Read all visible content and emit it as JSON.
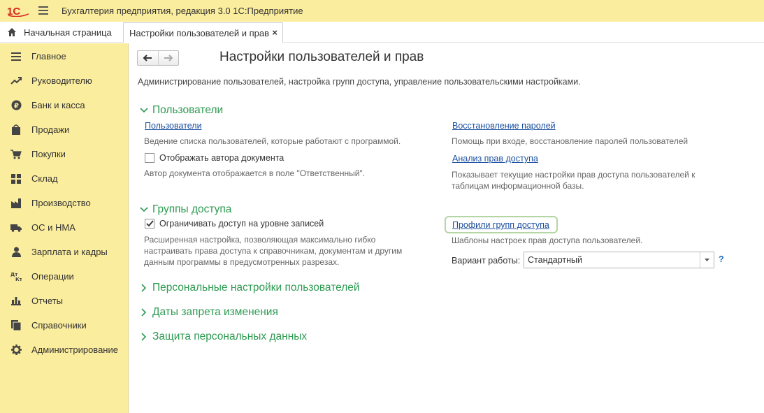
{
  "app": {
    "title": "Бухгалтерия предприятия, редакция 3.0 1С:Предприятие"
  },
  "tabs": {
    "home_label": "Начальная страница",
    "active_label": "Настройки пользователей и прав",
    "close_glyph": "×"
  },
  "sidebar": {
    "items": [
      {
        "label": "Главное",
        "icon": "list-icon"
      },
      {
        "label": "Руководителю",
        "icon": "trend-icon"
      },
      {
        "label": "Банк и касса",
        "icon": "ruble-icon"
      },
      {
        "label": "Продажи",
        "icon": "bag-icon"
      },
      {
        "label": "Покупки",
        "icon": "cart-icon"
      },
      {
        "label": "Склад",
        "icon": "grid-icon"
      },
      {
        "label": "Производство",
        "icon": "factory-icon"
      },
      {
        "label": "ОС и НМА",
        "icon": "truck-icon"
      },
      {
        "label": "Зарплата и кадры",
        "icon": "person-icon"
      },
      {
        "label": "Операции",
        "icon": "dt-kt-icon"
      },
      {
        "label": "Отчеты",
        "icon": "bar-chart-icon"
      },
      {
        "label": "Справочники",
        "icon": "books-icon"
      },
      {
        "label": "Администрирование",
        "icon": "gear-icon"
      }
    ]
  },
  "page": {
    "title": "Настройки пользователей и прав",
    "description": "Администрирование пользователей, настройка групп доступа, управление пользовательскими настройками."
  },
  "sections": {
    "users": {
      "title": "Пользователи",
      "users_link": "Пользователи",
      "users_hint": "Ведение списка пользователей, которые работают с программой.",
      "show_author_label": "Отображать автора документа",
      "show_author_checked": false,
      "show_author_hint": "Автор документа отображается в поле \"Ответственный\".",
      "restore_link": "Восстановление паролей",
      "restore_hint": "Помощь при входе, восстановление паролей пользователей",
      "analysis_link": "Анализ прав доступа",
      "analysis_hint_1": "Показывает текущие настройки прав доступа пользователей к",
      "analysis_hint_2": "таблицам информационной базы."
    },
    "groups": {
      "title": "Группы доступа",
      "restrict_label": "Ограничивать доступ на уровне записей",
      "restrict_checked": true,
      "restrict_hint_1": "Расширенная настройка, позволяющая максимально гибко",
      "restrict_hint_2": "настраивать права доступа к справочникам, документам и другим",
      "restrict_hint_3": "данным программы в предусмотренных разрезах.",
      "profiles_link": "Профили групп доступа",
      "profiles_hint": "Шаблоны настроек прав доступа пользователей.",
      "mode_label": "Вариант работы:",
      "mode_value": "Стандартный",
      "help_glyph": "?"
    },
    "personal": {
      "title": "Персональные настройки пользователей"
    },
    "dates": {
      "title": "Даты запрета изменения"
    },
    "protection": {
      "title": "Защита персональных данных"
    }
  },
  "colors": {
    "panel_bg": "#fbed9e",
    "section_green": "#2e9b52",
    "link_blue": "#1a4fa0"
  }
}
